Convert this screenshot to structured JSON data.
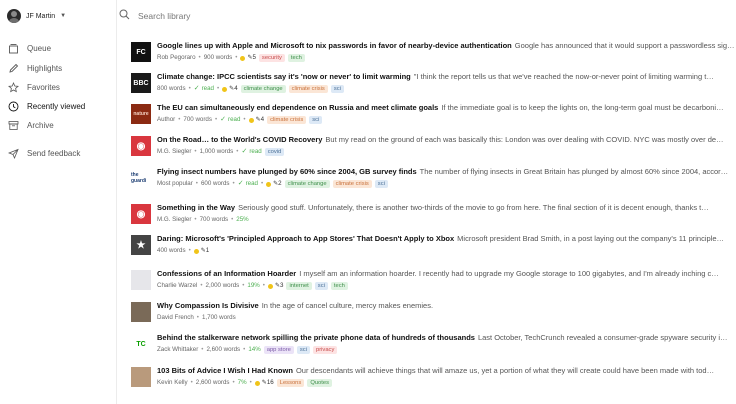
{
  "user": {
    "name": "JF Martin"
  },
  "search": {
    "placeholder": "Search library"
  },
  "nav": [
    {
      "label": "Queue",
      "icon": "queue-icon"
    },
    {
      "label": "Highlights",
      "icon": "pen-icon"
    },
    {
      "label": "Favorites",
      "icon": "star-icon"
    },
    {
      "label": "Recently viewed",
      "icon": "clock-icon",
      "active": true
    },
    {
      "label": "Archive",
      "icon": "archive-icon"
    },
    {
      "label": "Send feedback",
      "icon": "send-icon"
    }
  ],
  "articles": [
    {
      "thumb": "FC",
      "thumb_bg": "#111111",
      "thumb_fg": "#ffffff",
      "title": "Google lines up with Apple and Microsoft to nix passwords in favor of nearby-device authentication",
      "excerpt": "Google has announced that it would support a passwordless sign-in standard…",
      "author": "Rob Pegoraro",
      "words": "900 words",
      "read": "",
      "highlights": "5",
      "progress": "",
      "tags": [
        {
          "label": "security",
          "color": "red"
        },
        {
          "label": "tech",
          "color": "green"
        }
      ]
    },
    {
      "thumb": "BBC",
      "thumb_bg": "#1a1a1a",
      "thumb_fg": "#ffffff",
      "title": "Climate change: IPCC scientists say it's 'now or never' to limit warming",
      "excerpt": "\"I think the report tells us that we've reached the now-or-never point of limiting warming t…",
      "author": "",
      "words": "800 words",
      "read": "read",
      "highlights": "4",
      "progress": "",
      "tags": [
        {
          "label": "climate change",
          "color": "green"
        },
        {
          "label": "climate crisis",
          "color": "orange"
        },
        {
          "label": "sci",
          "color": "blue"
        }
      ]
    },
    {
      "thumb": "nature",
      "thumb_bg": "#8b2a12",
      "thumb_fg": "#f3d1c1",
      "title": "The EU can simultaneously end dependence on Russia and meet climate goals",
      "excerpt": "If the immediate goal is to keep the lights on, the long-term goal must be decarboni…",
      "author": "Author",
      "words": "700 words",
      "read": "read",
      "highlights": "4",
      "progress": "",
      "tags": [
        {
          "label": "climate crisis",
          "color": "orange"
        },
        {
          "label": "sci",
          "color": "blue"
        }
      ]
    },
    {
      "thumb": "◉",
      "thumb_bg": "#d9363e",
      "thumb_fg": "#ffffff",
      "title": "On the Road… to the World's COVID Recovery",
      "excerpt": "But my read on the ground of each was basically this: London was over dealing with COVID. NYC was mostly over de…",
      "author": "M.G. Siegler",
      "words": "1,000 words",
      "read": "read",
      "highlights": "",
      "progress": "",
      "tags": [
        {
          "label": "covid",
          "color": "blue"
        }
      ]
    },
    {
      "thumb": "the guardi",
      "thumb_bg": "#ffffff",
      "thumb_fg": "#1d3e73",
      "title": "Flying insect numbers have plunged by 60% since 2004, GB survey finds",
      "excerpt": "The number of flying insects in Great Britain has plunged by almost 60% since 2004, accor…",
      "author": "Most popular",
      "words": "600 words",
      "read": "read",
      "highlights": "2",
      "progress": "",
      "tags": [
        {
          "label": "climate change",
          "color": "green"
        },
        {
          "label": "climate crisis",
          "color": "orange"
        },
        {
          "label": "sci",
          "color": "blue"
        }
      ]
    },
    {
      "thumb": "◉",
      "thumb_bg": "#d9363e",
      "thumb_fg": "#ffffff",
      "title": "Something in the Way",
      "excerpt": "Seriously good stuff. Unfortunately, there is another two-thirds of the movie to go from here. The final section of it is decent enough, thanks t…",
      "author": "M.G. Siegler",
      "words": "700 words",
      "read": "",
      "highlights": "",
      "progress": "25%",
      "tags": []
    },
    {
      "thumb": "★",
      "thumb_bg": "#444444",
      "thumb_fg": "#ffffff",
      "title": "Daring: Microsoft's 'Principled Approach to App Stores' That Doesn't Apply to Xbox",
      "excerpt": "Microsoft president Brad Smith, in a post laying out the company's 11 principle…",
      "author": "",
      "words": "400 words",
      "read": "",
      "highlights": "1",
      "progress": "",
      "tags": []
    },
    {
      "thumb": "",
      "thumb_bg": "#e6e6ea",
      "thumb_fg": "#888888",
      "title": "Confessions of an Information Hoarder",
      "excerpt": "I myself am an information hoarder. I recently had to upgrade my Google storage to 100 gigabytes, and I'm already inching c…",
      "author": "Charlie Warzel",
      "words": "2,000 words",
      "read": "",
      "highlights": "3",
      "progress": "19%",
      "tags": [
        {
          "label": "internet",
          "color": "green"
        },
        {
          "label": "sci",
          "color": "blue"
        },
        {
          "label": "tech",
          "color": "green"
        }
      ]
    },
    {
      "thumb": "",
      "thumb_bg": "#7a6a58",
      "thumb_fg": "#ffffff",
      "title": "Why Compassion Is Divisive",
      "excerpt": "In the age of cancel culture, mercy makes enemies.",
      "author": "David French",
      "words": "1,700 words",
      "read": "",
      "highlights": "",
      "progress": "",
      "tags": []
    },
    {
      "thumb": "TC",
      "thumb_bg": "#ffffff",
      "thumb_fg": "#0a9e01",
      "title": "Behind the stalkerware network spilling the private phone data of hundreds of thousands",
      "excerpt": "Last October, TechCrunch revealed a consumer-grade spyware security i…",
      "author": "Zack Whittaker",
      "words": "2,600 words",
      "read": "",
      "highlights": "",
      "progress": "14%",
      "tags": [
        {
          "label": "app store",
          "color": "purple"
        },
        {
          "label": "sci",
          "color": "blue"
        },
        {
          "label": "privacy",
          "color": "red"
        }
      ]
    },
    {
      "thumb": "",
      "thumb_bg": "#b99a7c",
      "thumb_fg": "#ffffff",
      "title": "103 Bits of Advice I Wish I Had Known",
      "excerpt": "Our descendants will achieve things that will amaze us, yet a portion of what they will create could have been made with tod…",
      "author": "Kevin Kelly",
      "words": "2,600 words",
      "read": "",
      "highlights": "16",
      "progress": "7%",
      "tags": [
        {
          "label": "Lessons",
          "color": "orange"
        },
        {
          "label": "Quotes",
          "color": "green"
        }
      ]
    }
  ]
}
